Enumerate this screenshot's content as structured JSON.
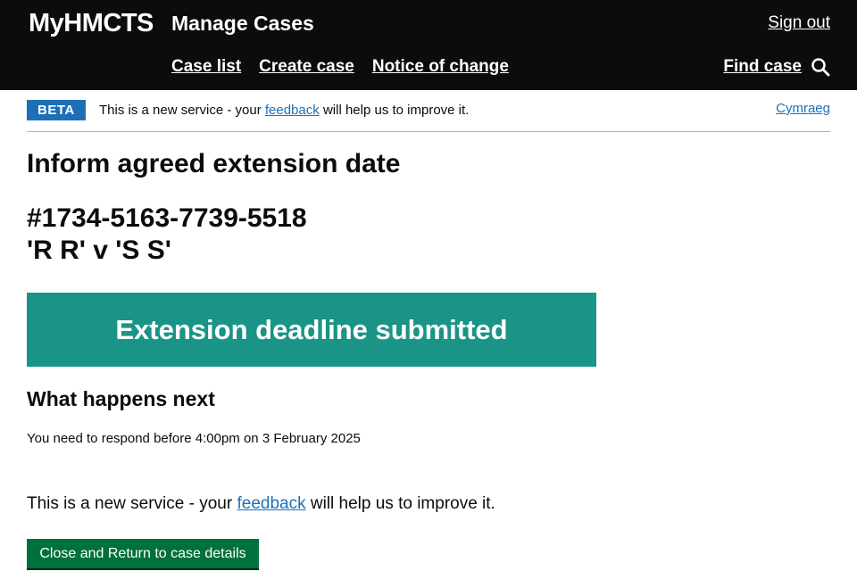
{
  "header": {
    "brand": "MyHMCTS",
    "service": "Manage Cases",
    "sign_out": "Sign out",
    "nav": [
      "Case list",
      "Create case",
      "Notice of change"
    ],
    "find_case": "Find case"
  },
  "phase_banner": {
    "tag": "BETA",
    "text_before": "This is a new service - your ",
    "link": "feedback",
    "text_after": " will help us to improve it.",
    "language": "Cymraeg"
  },
  "main": {
    "title": "Inform agreed extension date",
    "case_number": "#1734-5163-7739-5518",
    "case_name": "'R R' v 'S S'",
    "confirmation": "Extension deadline submitted",
    "next_heading": "What happens next",
    "respond_text": "You need to respond before 4:00pm on 3 February 2025",
    "feedback_before": "This is a new service - your ",
    "feedback_link": "feedback",
    "feedback_after": " will help us to improve it.",
    "button": "Close and Return to case details"
  }
}
